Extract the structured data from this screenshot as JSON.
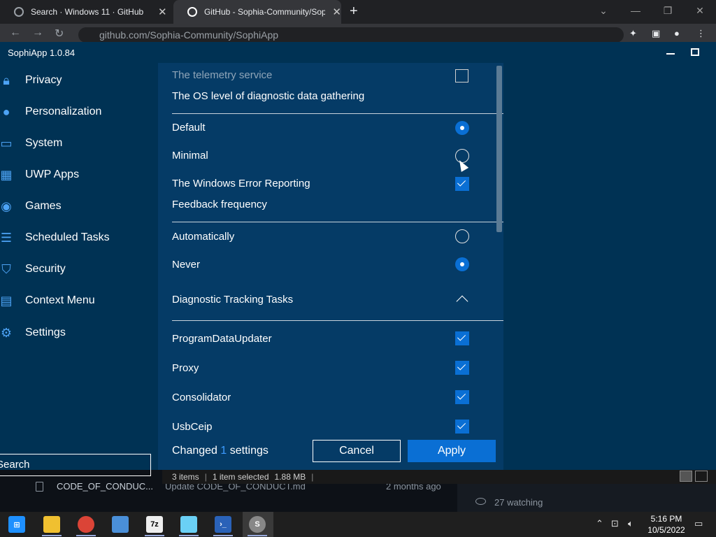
{
  "browser": {
    "tabs": [
      {
        "title": "Search · Windows 11 · GitHub"
      },
      {
        "title": "GitHub - Sophia-Community/Sophia"
      }
    ],
    "url": "github.com/Sophia-Community/SophiApp"
  },
  "app": {
    "title": "SophiApp 1.0.84",
    "sidebar": [
      {
        "label": "Privacy",
        "icon": "lock-icon"
      },
      {
        "label": "Personalization",
        "icon": "person-icon"
      },
      {
        "label": "System",
        "icon": "monitor-icon"
      },
      {
        "label": "UWP Apps",
        "icon": "apps-icon"
      },
      {
        "label": "Games",
        "icon": "gamepad-icon"
      },
      {
        "label": "Scheduled Tasks",
        "icon": "tasks-icon"
      },
      {
        "label": "Security",
        "icon": "shield-icon"
      },
      {
        "label": "Context Menu",
        "icon": "context-menu-icon"
      },
      {
        "label": "Settings",
        "icon": "gear-icon"
      }
    ],
    "search_placeholder": "Search",
    "settings": {
      "telemetry_service": "The telemetry service",
      "diagnostic_header": "The OS level of diagnostic data gathering",
      "option_default": "Default",
      "option_minimal": "Minimal",
      "error_reporting": "The Windows Error Reporting",
      "feedback_header": "Feedback frequency",
      "option_automatically": "Automatically",
      "option_never": "Never",
      "tracking_tasks": "Diagnostic Tracking Tasks",
      "tasks": [
        "ProgramDataUpdater",
        "Proxy",
        "Consolidator",
        "UsbCeip"
      ]
    },
    "footer": {
      "changed_prefix": "Changed",
      "changed_count": "1",
      "changed_suffix": "settings",
      "cancel": "Cancel",
      "apply": "Apply"
    }
  },
  "behind": {
    "file_name": "CODE_OF_CONDUC...",
    "commit_msg": "Update CODE_OF_CONDUCT.md",
    "commit_age": "2 months ago",
    "watching": "27 watching"
  },
  "statusbar": {
    "items": "3 items",
    "selected": "1 item selected",
    "size": "1.88 MB"
  },
  "taskbar": {
    "time": "5:16 PM",
    "date": "10/5/2022"
  },
  "colors": {
    "accent": "#0a6fd4",
    "app_bg": "#003254",
    "content_bg": "#053b66"
  }
}
